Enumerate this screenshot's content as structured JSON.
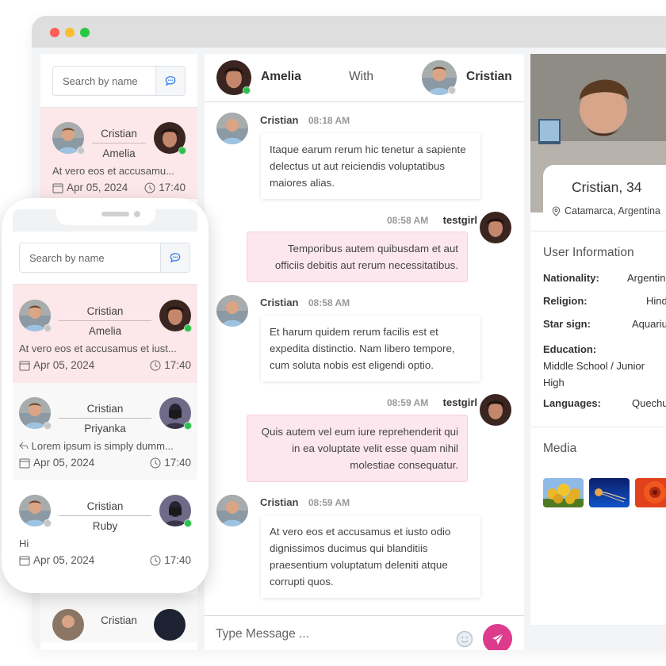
{
  "window": {
    "controls": [
      "close",
      "minimize",
      "maximize"
    ]
  },
  "sidebar": {
    "search_placeholder": "Search by name",
    "search_icon": "chat-bubble-icon",
    "conversations": [
      {
        "user_a": "Cristian",
        "user_b": "Amelia",
        "preview": "At vero eos et accusamu...",
        "date": "Apr 05, 2024",
        "time": "17:40",
        "active": true,
        "user_a_status": "offline",
        "user_b_status": "online"
      },
      {
        "user_a": "Cristian",
        "user_b": "",
        "preview": "",
        "date": "",
        "time": ""
      }
    ]
  },
  "phone": {
    "search_placeholder": "Search by name",
    "conversations": [
      {
        "user_a": "Cristian",
        "user_b": "Amelia",
        "preview": "At vero eos et accusamus et iust...",
        "date": "Apr 05, 2024",
        "time": "17:40",
        "user_a_status": "offline",
        "user_b_status": "online",
        "replied": false
      },
      {
        "user_a": "Cristian",
        "user_b": "Priyanka",
        "preview": "Lorem ipsum is simply dumm...",
        "date": "Apr 05, 2024",
        "time": "17:40",
        "user_a_status": "offline",
        "user_b_status": "online",
        "replied": true
      },
      {
        "user_a": "Cristian",
        "user_b": "Ruby",
        "preview": "Hi",
        "date": "Apr 05, 2024",
        "time": "17:40",
        "user_a_status": "offline",
        "user_b_status": "online",
        "replied": false
      }
    ]
  },
  "chat": {
    "header": {
      "left_user": "Amelia",
      "left_status": "online",
      "with_label": "With",
      "right_user": "Cristian",
      "right_status": "offline"
    },
    "messages": [
      {
        "sender": "Cristian",
        "time": "08:18 AM",
        "direction": "in",
        "text": "Itaque earum rerum hic tenetur a sapiente delectus ut aut reiciendis voluptatibus maiores alias."
      },
      {
        "sender": "testgirl",
        "time": "08:58 AM",
        "direction": "out",
        "text": "Temporibus autem quibusdam et aut officiis debitis aut rerum necessitatibus."
      },
      {
        "sender": "Cristian",
        "time": "08:58 AM",
        "direction": "in",
        "text": "Et harum quidem rerum facilis est et expedita distinctio. Nam libero tempore, cum soluta nobis est eligendi optio."
      },
      {
        "sender": "testgirl",
        "time": "08:59 AM",
        "direction": "out",
        "text": "Quis autem vel eum iure reprehenderit qui in ea voluptate velit esse quam nihil molestiae consequatur."
      },
      {
        "sender": "Cristian",
        "time": "08:59 AM",
        "direction": "in",
        "text": "At vero eos et accusamus et iusto odio dignissimos ducimus qui blanditiis praesentium voluptatum deleniti atque corrupti quos."
      }
    ],
    "composer": {
      "placeholder": "Type Message ...",
      "emoji_icon": "smiley-icon",
      "send_icon": "paper-plane-icon"
    }
  },
  "profile": {
    "name_age": "Cristian, 34",
    "location": "Catamarca, Argentina",
    "info_title": "User Information",
    "info": [
      {
        "label": "Nationality:",
        "value": "Argentina"
      },
      {
        "label": "Religion:",
        "value": "Hindu"
      },
      {
        "label": "Star sign:",
        "value": "Aquarius"
      },
      {
        "label": "Education:",
        "value": "Middle School / Junior High"
      },
      {
        "label": "Languages:",
        "value": "Quechua"
      }
    ],
    "media_title": "Media",
    "media": [
      "yellow-tulips",
      "jellyfish",
      "orange-flower"
    ]
  },
  "colors": {
    "accent": "#dd3b8c",
    "active_conv_bg": "#fce7ea",
    "outgoing_bubble_bg": "#fce7ee",
    "online": "#2fbf4e",
    "offline": "#c6c6c6",
    "search_icon": "#2f7ef0"
  }
}
